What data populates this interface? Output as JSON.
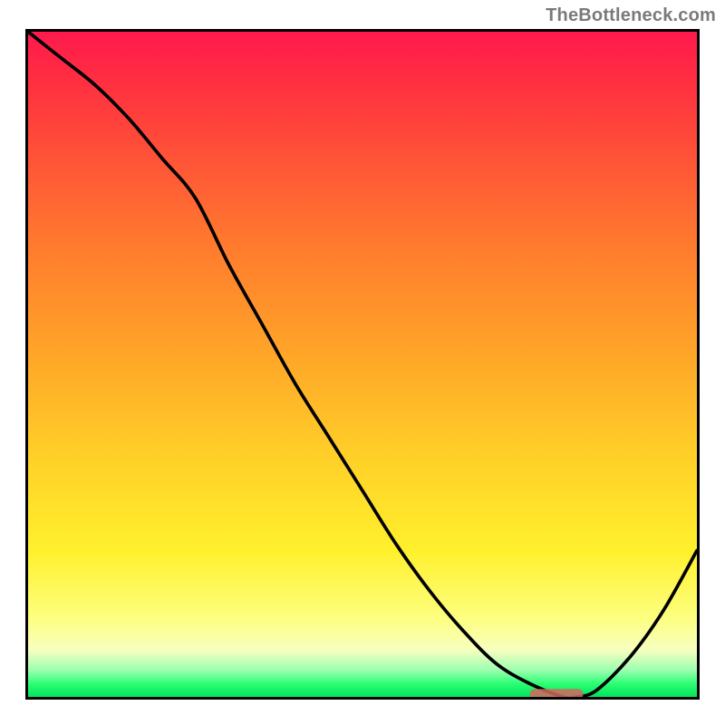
{
  "watermark": "TheBottleneck.com",
  "colors": {
    "stroke": "#000000",
    "marker": "#d4675f",
    "border": "#000000"
  },
  "chart_data": {
    "type": "line",
    "title": "",
    "xlabel": "",
    "ylabel": "",
    "xlim": [
      0,
      100
    ],
    "ylim": [
      0,
      100
    ],
    "grid": false,
    "x": [
      0,
      5,
      10,
      15,
      20,
      25,
      30,
      35,
      40,
      45,
      50,
      55,
      60,
      65,
      70,
      75,
      80,
      82,
      85,
      90,
      95,
      100
    ],
    "values": [
      100,
      96,
      92,
      87,
      81,
      75,
      65,
      56,
      47,
      39,
      31,
      23,
      16,
      10,
      5,
      2,
      0,
      0,
      1,
      6,
      13,
      22
    ],
    "marker": {
      "x_start": 75,
      "x_end": 83,
      "y": 0
    },
    "series": [
      {
        "name": "curve",
        "x_ref": "x",
        "values_ref": "values"
      }
    ]
  }
}
